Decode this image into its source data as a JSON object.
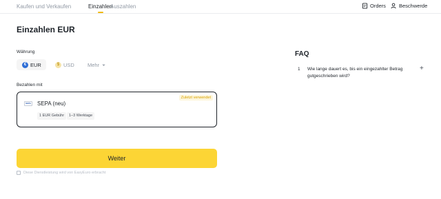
{
  "nav": {
    "tabs": [
      "Kaufen und Verkaufen",
      "Einzahlen",
      "Auszahlen"
    ],
    "orders_label": "Orders",
    "complaints_label": "Beschwerde"
  },
  "page": {
    "title": "Einzahlen EUR"
  },
  "currency": {
    "label": "Währung",
    "options": [
      "EUR",
      "USD"
    ],
    "selected": "EUR",
    "more_label": "Mehr"
  },
  "payment": {
    "label": "Bezahlen mit",
    "method_name": "SEPA (neu)",
    "badge": "Zuletzt verwendet",
    "fee": "1 EUR Gebühr",
    "duration": "1–3 Werktage",
    "logo_text": "SEPA"
  },
  "cta": {
    "label": "Weiter"
  },
  "footnote": "Diese Dienstleistung wird von EasyEuro erbracht",
  "faq": {
    "title": "FAQ",
    "items": [
      {
        "num": "1",
        "question": "Wie lange dauert es, bis ein eingezahlter Betrag gutgeschrieben wird?"
      }
    ]
  },
  "colors": {
    "accent": "#fcd535",
    "brand": "#f0b90b",
    "eur_coin": "#2f6fd6"
  }
}
